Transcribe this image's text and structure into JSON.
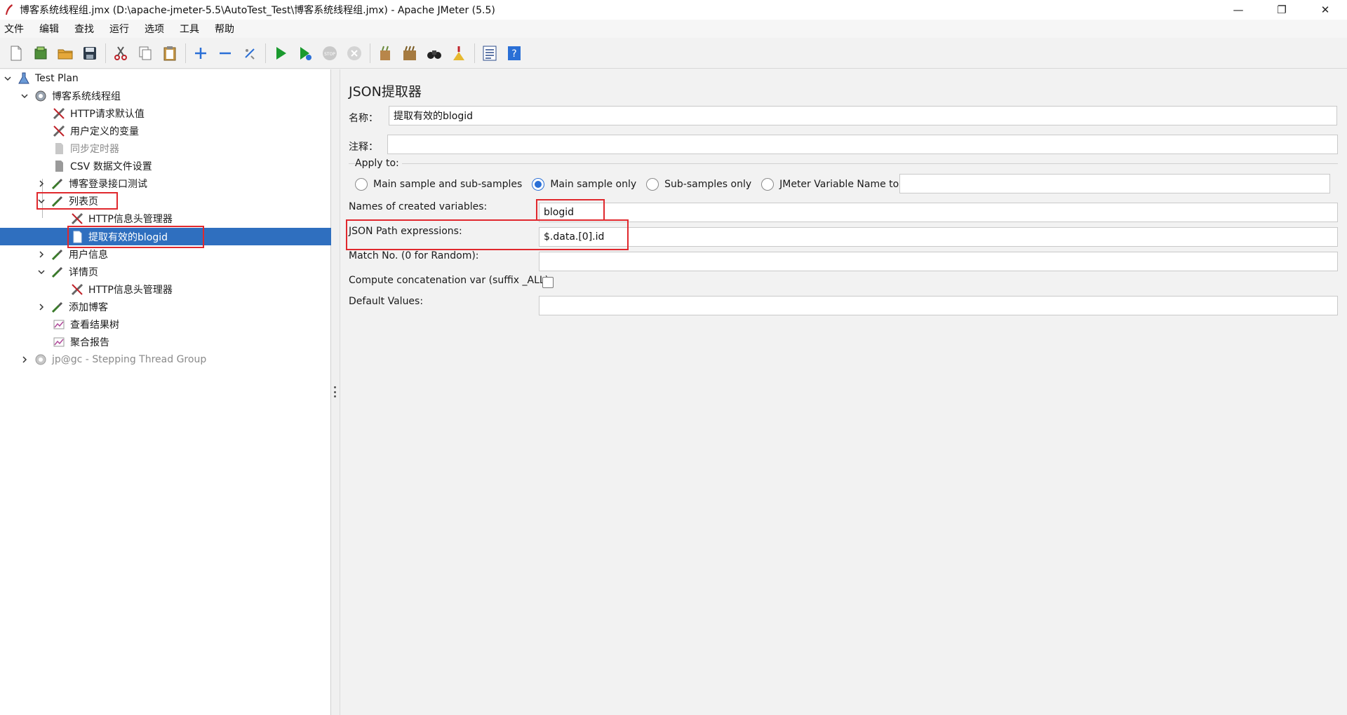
{
  "window": {
    "title": "博客系统线程组.jmx (D:\\apache-jmeter-5.5\\AutoTest_Test\\博客系统线程组.jmx) - Apache JMeter (5.5)",
    "minimize": "—",
    "restore": "❐",
    "close": "✕"
  },
  "menu": [
    "文件",
    "编辑",
    "查找",
    "运行",
    "选项",
    "工具",
    "帮助"
  ],
  "toolbar": [
    "new-icon",
    "templates-icon",
    "open-icon",
    "save-icon",
    "cut-icon",
    "copy-icon",
    "paste-icon",
    "expand-icon",
    "collapse-icon",
    "toggle-icon",
    "start-icon",
    "start-no-pause-icon",
    "stop-icon",
    "shutdown-icon",
    "clear-icon",
    "clear-all-icon",
    "search-icon",
    "reset-search-icon",
    "function-helper-icon",
    "help-icon"
  ],
  "tree": {
    "nodes": [
      {
        "label": "Test Plan",
        "icon": "test-plan-icon",
        "expanded": true
      },
      {
        "label": "博客系统线程组",
        "icon": "thread-group-icon",
        "expanded": true
      },
      {
        "label": "HTTP请求默认值",
        "icon": "config-tool-icon"
      },
      {
        "label": "用户定义的变量",
        "icon": "config-tool-icon"
      },
      {
        "label": "同步定时器",
        "icon": "timer-icon",
        "disabled": true
      },
      {
        "label": "CSV 数据文件设置",
        "icon": "csv-icon"
      },
      {
        "label": "博客登录接口测试",
        "icon": "sampler-icon",
        "expanded": false
      },
      {
        "label": "列表页",
        "icon": "sampler-icon",
        "expanded": true
      },
      {
        "label": "HTTP信息头管理器",
        "icon": "config-tool-icon"
      },
      {
        "label": "提取有效的blogid",
        "icon": "extractor-icon",
        "selected": true
      },
      {
        "label": "用户信息",
        "icon": "sampler-icon",
        "expanded": false
      },
      {
        "label": "详情页",
        "icon": "sampler-icon",
        "expanded": true
      },
      {
        "label": "HTTP信息头管理器",
        "icon": "config-tool-icon"
      },
      {
        "label": "添加博客",
        "icon": "sampler-icon",
        "expanded": false
      },
      {
        "label": "查看结果树",
        "icon": "listener-icon"
      },
      {
        "label": "聚合报告",
        "icon": "listener-icon"
      },
      {
        "label": "jp@gc - Stepping Thread Group",
        "icon": "thread-group-icon",
        "disabled": true,
        "expanded": false
      }
    ]
  },
  "form": {
    "title": "JSON提取器",
    "name_label": "名称：",
    "name_value": "提取有效的blogid",
    "comment_label": "注释：",
    "comment_value": "",
    "apply_to_label": "Apply to:",
    "apply_options": [
      {
        "label": "Main sample and sub-samples",
        "selected": false
      },
      {
        "label": "Main sample only",
        "selected": true
      },
      {
        "label": "Sub-samples only",
        "selected": false
      },
      {
        "label": "JMeter Variable Name to use",
        "selected": false
      }
    ],
    "jmeter_var_value": "",
    "var_names_label": "Names of created variables:",
    "var_names_value": "blogid",
    "json_path_label": "JSON Path expressions:",
    "json_path_value": "$.data.[0].id",
    "match_no_label": "Match No. (0 for Random):",
    "match_no_value": "",
    "concat_label": "Compute concatenation var (suffix _ALL):",
    "concat_checked": false,
    "default_label": "Default Values:",
    "default_value": ""
  },
  "colors": {
    "selection": "#2f6fbf",
    "highlight_box": "#e0282d",
    "radio_accent": "#2a6fd6"
  }
}
